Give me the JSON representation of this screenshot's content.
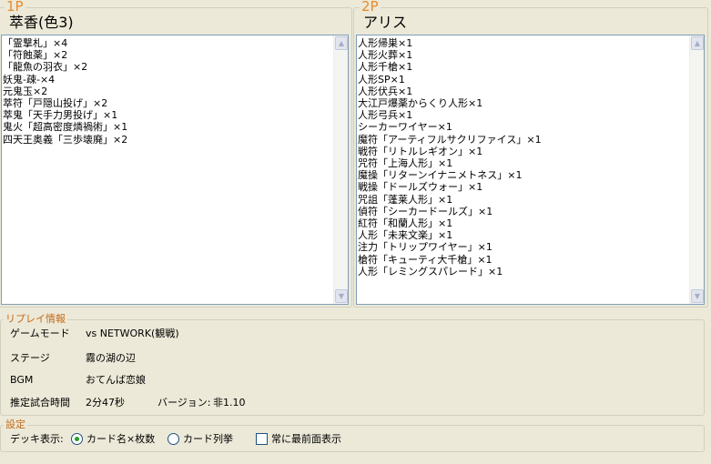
{
  "p1": {
    "legend": "1P",
    "character": "萃香(色3)",
    "cards": [
      "「霊撃札」×4",
      "「符蝕薬」×2",
      "「龍魚の羽衣」×2",
      "妖鬼-疎-×4",
      "元鬼玉×2",
      "萃符「戸隠山投げ」×2",
      "萃鬼「天手力男投げ」×1",
      "鬼火「超高密度燐禍術」×1",
      "四天王奥義「三歩壊廃」×2"
    ]
  },
  "p2": {
    "legend": "2P",
    "character": "アリス",
    "cards": [
      "人形帰巣×1",
      "人形火葬×1",
      "人形千槍×1",
      "人形SP×1",
      "人形伏兵×1",
      "大江戸爆薬からくり人形×1",
      "人形弓兵×1",
      "シーカーワイヤー×1",
      "魔符「アーティフルサクリファイス」×1",
      "戦符「リトルレギオン」×1",
      "咒符「上海人形」×1",
      "魔操「リターンイナニメトネス」×1",
      "戦操「ドールズウォー」×1",
      "咒詛「蓬莱人形」×1",
      "偵符「シーカードールズ」×1",
      "紅符「和蘭人形」×1",
      "人形「未来文楽」×1",
      "注力「トリップワイヤー」×1",
      "槍符「キューティ大千槍」×1",
      "人形「レミングスパレード」×1"
    ]
  },
  "replay_info": {
    "legend": "リプレイ情報",
    "game_mode_label": "ゲームモード",
    "game_mode_value": "vs NETWORK(観戦)",
    "stage_label": "ステージ",
    "stage_value": "霧の湖の辺",
    "bgm_label": "BGM",
    "bgm_value": "おてんば恋娘",
    "time_label": "推定試合時間",
    "time_value": "2分47秒",
    "version_label": "バージョン:",
    "version_value": "非1.10"
  },
  "settings": {
    "legend": "設定",
    "deck_display_label": "デッキ表示:",
    "option_name_count": "カード名×枚数",
    "option_list": "カード列挙",
    "always_on_top": "常に最前面表示",
    "selected": "option_name_count",
    "always_on_top_checked": false
  }
}
